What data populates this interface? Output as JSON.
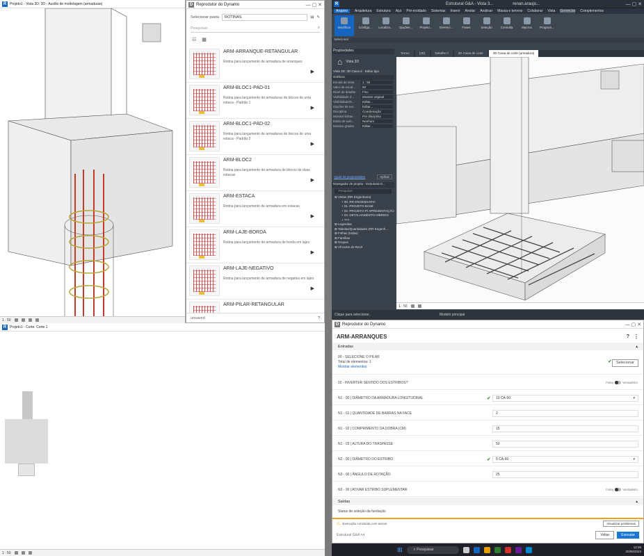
{
  "view3d_window": {
    "title": "Projeto1 - Vista 3D: 3D - Auxílio de modelagem (armaduras)",
    "scale": "1 : 50"
  },
  "section_window": {
    "title": "Projeto1 - Corte: Corte 1",
    "scale": "1 : 50"
  },
  "dynamo_list": {
    "title": "Reprodutor do Dynamo",
    "folder_label": "Selecionar pasta",
    "folder_value": "ROTINAS",
    "search_placeholder": "Pesquisar",
    "status": "unsaved",
    "items": [
      {
        "name": "ARM-ARRANQUE-RETANGULAR",
        "desc": "Rotina para lançamento de armadura de arranques"
      },
      {
        "name": "ARM-BLOC1-PAD-01",
        "desc": "Rotina para lançamento de armaduras de blocos de uma estaca - Padrão 1"
      },
      {
        "name": "ARM-BLOC1-PAD-02",
        "desc": "Rotina para lançamento de armaduras de blocos de uma estaca - Padrão 2"
      },
      {
        "name": "ARM-BLOC2",
        "desc": "Rotina para lançamento de armadura de blocos de duas estacas"
      },
      {
        "name": "ARM-ESTACA",
        "desc": "Rotina para lançamento de armadura em estacas"
      },
      {
        "name": "ARM-LAJE-BORDA",
        "desc": "Rotina para lançamento de armadura de borda em lajes"
      },
      {
        "name": "ARM-LAJE-NEGATIVO",
        "desc": "Rotina para lançamento de armadura de negativa em lajes"
      },
      {
        "name": "ARM-PILAR-RETANGULAR",
        "desc": ""
      }
    ]
  },
  "revit": {
    "title": "Estrutural G&A - Vista 3...",
    "user": "renan.araujo...",
    "ribbon_tabs": [
      "Arquivo",
      "Arquitetura",
      "Estrutura",
      "Aço",
      "Pré-moldado",
      "Sistemas",
      "Inserir",
      "Anotar",
      "Analisar",
      "Massa e terreno",
      "Colaborar",
      "Vista",
      "Gerenciar",
      "Complementos"
    ],
    "ribbon_buttons": [
      "Modificar",
      "Configu...",
      "Localiza...",
      "Opções...",
      "Projeto...",
      "Gerenci...",
      "Fases",
      "Seleção",
      "Consulta",
      "Macros",
      "Program..."
    ],
    "ribbon_footer": "Selecionar",
    "doc_tabs": [
      "Terreo",
      "{3D}",
      "Detalhe 0",
      "3D Caixa de corte",
      "3D Caixa de corte (armadura)"
    ],
    "props_title": "Propriedades",
    "props_type": "Vista 3D",
    "props_selector": "Vista 3D: 3D Caixa d",
    "props_edit": "Editar tipo",
    "props_group": "Gráficos",
    "props_rows": [
      [
        "Escala de vista",
        "1 : 50"
      ],
      [
        "Valor de escal...",
        "50"
      ],
      [
        "Nível de detalhe",
        "Fino"
      ],
      [
        "Visibilidade d...",
        "Mostrar original"
      ],
      [
        "Visibilidade/S...",
        "Editar..."
      ],
      [
        "Opções de exi...",
        "Editar..."
      ],
      [
        "Disciplina",
        "Coordenação"
      ],
      [
        "Mostrar linhas...",
        "Por disciplina"
      ],
      [
        "Estilo de exib...",
        "Nenhum"
      ],
      [
        "Mostrar grades",
        "Editar..."
      ]
    ],
    "props_help": "Ajuda de propriedades",
    "props_apply": "Aplicar",
    "browser_title": "Navegador de projeto - Estrutural G...",
    "browser_search": "Pesquisar",
    "browser_items": [
      "Vistas (RR Engenharia)",
      "00. RR ENGENHARIA",
      "01. PROJETO BASE",
      "02. PROJETO P/ APRESENTAÇÃO",
      "03. DETALHAMENTO HÍBRIDO",
      "???",
      "Legendas",
      "Tabelas/Quantidades (RR Engenh...",
      "Folhas (todas)",
      "Famílias",
      "Grupos",
      "Vínculos do Revit"
    ],
    "status": "Clique para selecionar,",
    "model": "Modelo principal",
    "scale": "1 : 50"
  },
  "dynamo_form": {
    "title": "Reprodutor do Dynamo",
    "script": "ARM-ARRANQUES",
    "inputs_header": "Entradas",
    "select_label": "00 - SELECIONE O PILAR",
    "select_total": "Total de elementos: 1",
    "select_show": "Mostrar elementos",
    "select_button": "Selecionar",
    "invert_label": "02 - INVERTER SENTIDO DOS ESTRIBOS?",
    "false_label": "Falso",
    "true_label": "Verdadeiro",
    "fields": [
      {
        "label": "N1 - 00 | DIÂMETRO DA ARMADURA LONGITUDINAL",
        "value": "10 CA-50"
      },
      {
        "label": "N1 - 01 | QUANTIDADE DE BARRAS NA FACE",
        "value": "2"
      },
      {
        "label": "N1 - 02 | COMPRIMENTO DA DOBRA (CM)",
        "value": "15"
      },
      {
        "label": "N1 - 03 | ALTURA DO TRASPASSE",
        "value": "50"
      },
      {
        "label": "N2 - 00 | DIÂMETRO DO ESTRIBO",
        "value": "5 CA-60"
      },
      {
        "label": "N3 - 00 | ÂNGULO DE ROTAÇÃO",
        "value": "25"
      }
    ],
    "supp_label": "N3 - 00 | ATIVAR ESTRIBO SUPLEMENTAR",
    "outputs_header": "Saídas",
    "output_status": "Status de seleção da fundação",
    "warning": "Execução concluída com avisos",
    "problems_button": "Visualizar problemas",
    "footer": "Estrutural G&A rvt",
    "back_button": "Voltar",
    "run_button": "Executar"
  },
  "taskbar": {
    "search": "Pesquisar",
    "time": "12:26",
    "date": "20/06/2023"
  }
}
